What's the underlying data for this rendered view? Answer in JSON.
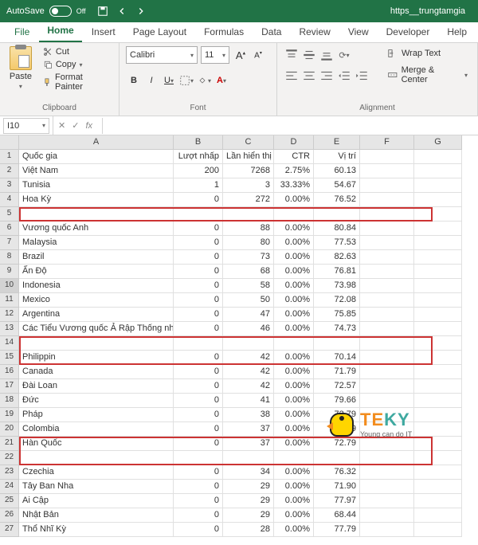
{
  "titlebar": {
    "autosave_label": "AutoSave",
    "autosave_state": "Off",
    "doc_title": "https__trungtamgia"
  },
  "tabs": [
    "File",
    "Home",
    "Insert",
    "Page Layout",
    "Formulas",
    "Data",
    "Review",
    "View",
    "Developer",
    "Help"
  ],
  "active_tab_index": 1,
  "ribbon": {
    "clipboard": {
      "paste": "Paste",
      "cut": "Cut",
      "copy": "Copy",
      "format_painter": "Format Painter",
      "group_label": "Clipboard"
    },
    "font": {
      "name": "Calibri",
      "size": "11",
      "inc_label": "A",
      "dec_label": "A",
      "bold": "B",
      "italic": "I",
      "underline": "U",
      "group_label": "Font"
    },
    "alignment": {
      "wrap_text": "Wrap Text",
      "merge_center": "Merge & Center",
      "group_label": "Alignment"
    }
  },
  "name_box": "I10",
  "fx_label": "fx",
  "columns": [
    "A",
    "B",
    "C",
    "D",
    "E",
    "F",
    "G"
  ],
  "headers": {
    "A": "Quốc gia",
    "B": "Lượt nhấp",
    "C": "Lần hiển thị",
    "D": "CTR",
    "E": "Vị trí"
  },
  "rows": [
    {
      "n": 1,
      "A": "Quốc gia",
      "B": "Lượt nhấp",
      "C": "Lần hiển thị",
      "D": "CTR",
      "E": "Vị trí"
    },
    {
      "n": 2,
      "A": "Việt Nam",
      "B": "200",
      "C": "7268",
      "D": "2.75%",
      "E": "60.13"
    },
    {
      "n": 3,
      "A": "Tunisia",
      "B": "1",
      "C": "3",
      "D": "33.33%",
      "E": "54.67"
    },
    {
      "n": 4,
      "A": "Hoa Kỳ",
      "B": "0",
      "C": "272",
      "D": "0.00%",
      "E": "76.52"
    },
    {
      "n": 5,
      "A": "",
      "B": "",
      "C": "",
      "D": "",
      "E": ""
    },
    {
      "n": 6,
      "A": "Vương quốc Anh",
      "B": "0",
      "C": "88",
      "D": "0.00%",
      "E": "80.84"
    },
    {
      "n": 7,
      "A": "Malaysia",
      "B": "0",
      "C": "80",
      "D": "0.00%",
      "E": "77.53"
    },
    {
      "n": 8,
      "A": "Brazil",
      "B": "0",
      "C": "73",
      "D": "0.00%",
      "E": "82.63"
    },
    {
      "n": 9,
      "A": "Ấn Độ",
      "B": "0",
      "C": "68",
      "D": "0.00%",
      "E": "76.81"
    },
    {
      "n": 10,
      "A": "Indonesia",
      "B": "0",
      "C": "58",
      "D": "0.00%",
      "E": "73.98"
    },
    {
      "n": 11,
      "A": "Mexico",
      "B": "0",
      "C": "50",
      "D": "0.00%",
      "E": "72.08"
    },
    {
      "n": 12,
      "A": "Argentina",
      "B": "0",
      "C": "47",
      "D": "0.00%",
      "E": "75.85"
    },
    {
      "n": 13,
      "A": "Các Tiểu Vương quốc Ả Rập Thống nhất",
      "B": "0",
      "C": "46",
      "D": "0.00%",
      "E": "74.73"
    },
    {
      "n": 14,
      "A": "",
      "B": "",
      "C": "",
      "D": "",
      "E": ""
    },
    {
      "n": 15,
      "A": "Philippin",
      "B": "0",
      "C": "42",
      "D": "0.00%",
      "E": "70.14"
    },
    {
      "n": 16,
      "A": "Canada",
      "B": "0",
      "C": "42",
      "D": "0.00%",
      "E": "71.79"
    },
    {
      "n": 17,
      "A": "Đài Loan",
      "B": "0",
      "C": "42",
      "D": "0.00%",
      "E": "72.57"
    },
    {
      "n": 18,
      "A": "Đức",
      "B": "0",
      "C": "41",
      "D": "0.00%",
      "E": "79.66"
    },
    {
      "n": 19,
      "A": "Pháp",
      "B": "0",
      "C": "38",
      "D": "0.00%",
      "E": "72.79"
    },
    {
      "n": 20,
      "A": "Colombia",
      "B": "0",
      "C": "37",
      "D": "0.00%",
      "E": "72.79"
    },
    {
      "n": 21,
      "A": "Hàn Quốc",
      "B": "0",
      "C": "37",
      "D": "0.00%",
      "E": "72.79"
    },
    {
      "n": 22,
      "A": "",
      "B": "",
      "C": "",
      "D": "",
      "E": ""
    },
    {
      "n": 23,
      "A": "Czechia",
      "B": "0",
      "C": "34",
      "D": "0.00%",
      "E": "76.32"
    },
    {
      "n": 24,
      "A": "Tây Ban Nha",
      "B": "0",
      "C": "29",
      "D": "0.00%",
      "E": "71.90"
    },
    {
      "n": 25,
      "A": "Ai Cập",
      "B": "0",
      "C": "29",
      "D": "0.00%",
      "E": "77.97"
    },
    {
      "n": 26,
      "A": "Nhật Bản",
      "B": "0",
      "C": "29",
      "D": "0.00%",
      "E": "68.44"
    },
    {
      "n": 27,
      "A": "Thổ Nhĩ Kỳ",
      "B": "0",
      "C": "28",
      "D": "0.00%",
      "E": "77.79"
    }
  ],
  "teky": {
    "brand": "TEKY",
    "tagline": "Young can do IT"
  }
}
